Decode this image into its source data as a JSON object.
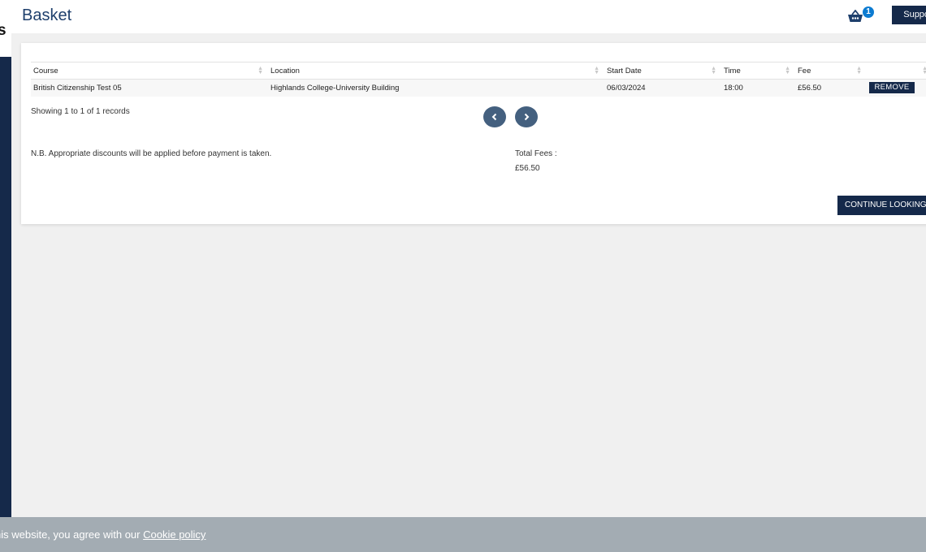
{
  "sidebar": {
    "letter": "s"
  },
  "header": {
    "title": "Basket",
    "basket_count": "1",
    "support_label": "Support"
  },
  "table": {
    "columns": [
      "Course",
      "Location",
      "Start Date",
      "Time",
      "Fee"
    ],
    "rows": [
      {
        "course": "British Citizenship Test 05",
        "location": "Highlands College-University Building",
        "start_date": "06/03/2024",
        "time": "18:00",
        "fee": "£56.50",
        "action": "REMOVE"
      }
    ]
  },
  "records_info": "Showing 1 to 1 of 1 records",
  "discount_note": "N.B. Appropriate discounts will be applied before payment is taken.",
  "total": {
    "label": "Total Fees :",
    "value": "£56.50"
  },
  "continue_label": "CONTINUE LOOKING",
  "cookie": {
    "text": "his website, you agree with our",
    "link": "Cookie policy"
  },
  "colors": {
    "navy": "#15294a",
    "title_blue": "#1e3f6c",
    "badge_blue": "#0c7bd1",
    "pager": "#44607f",
    "cookie_bar": "#a3acb3"
  }
}
